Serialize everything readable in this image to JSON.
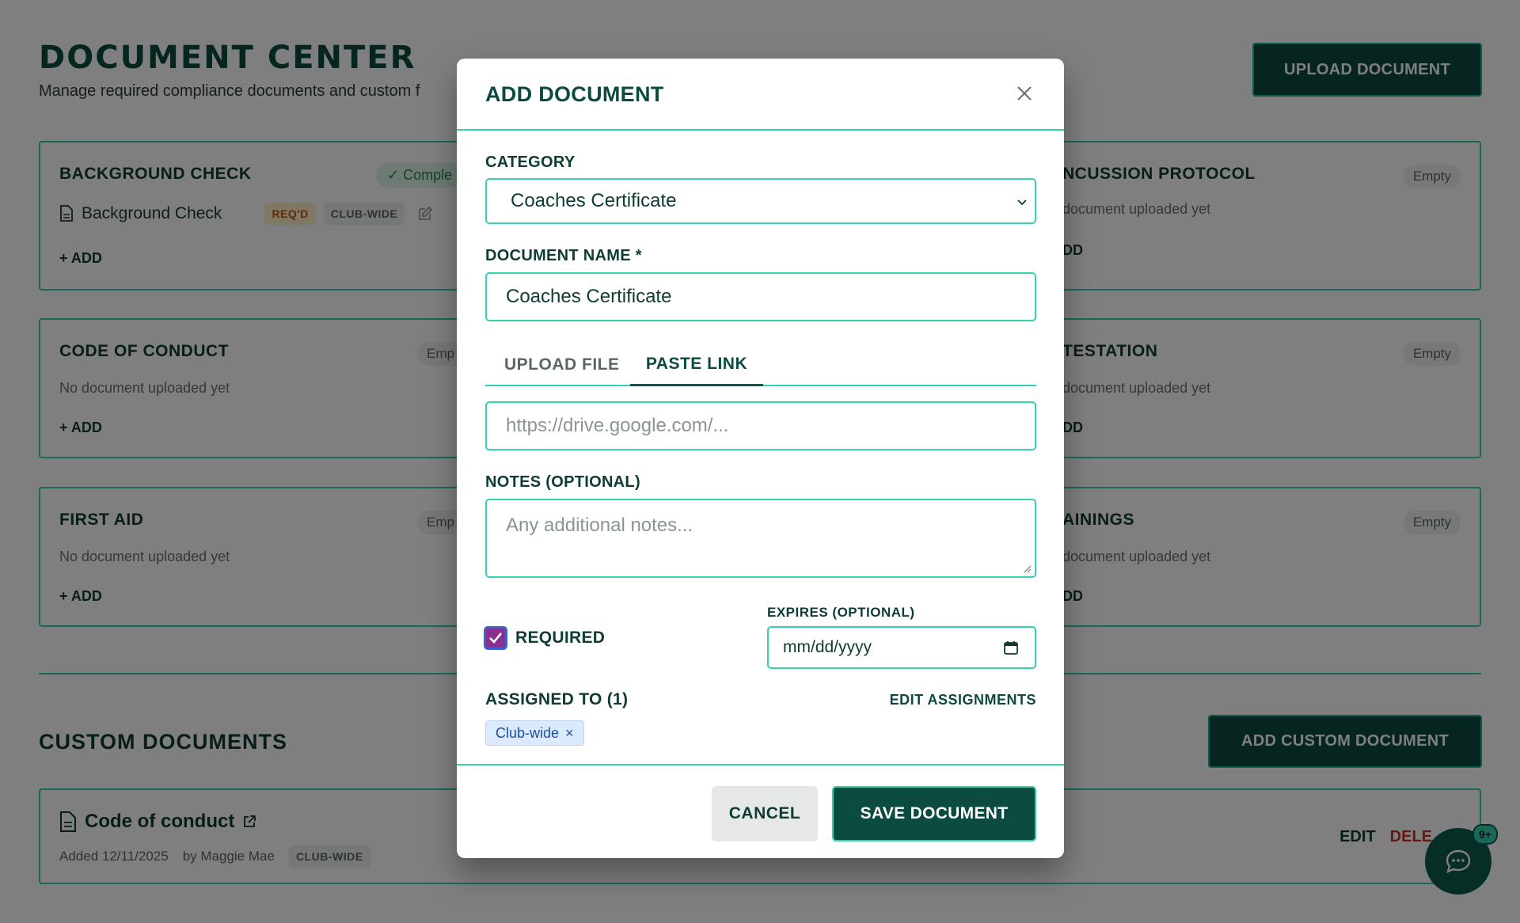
{
  "page": {
    "title": "DOCUMENT CENTER",
    "subtitle": "Manage required compliance documents and custom f",
    "upload_button": "UPLOAD DOCUMENT",
    "cards": [
      {
        "title": "BACKGROUND CHECK",
        "status": "Comple",
        "doc_name": "Background Check",
        "req_pill": "REQ'D",
        "club_pill": "CLUB-WIDE",
        "add": "+ ADD"
      },
      {
        "title": "NCUSSION PROTOCOL",
        "status": "Empty",
        "empty_text": "document uploaded yet",
        "add": "DD"
      },
      {
        "title": "CODE OF CONDUCT",
        "status": "Emp",
        "empty_text": "No document uploaded yet",
        "add": "+ ADD"
      },
      {
        "title": "TESTATION",
        "status": "Empty",
        "empty_text": "document uploaded yet",
        "add": "DD"
      },
      {
        "title": "FIRST AID",
        "status": "Emp",
        "empty_text": "No document uploaded yet",
        "add": "+ ADD"
      },
      {
        "title": "AININGS",
        "status": "Empty",
        "empty_text": "document uploaded yet",
        "add": "DD"
      }
    ],
    "custom_section_title": "CUSTOM DOCUMENTS",
    "add_custom_button": "ADD CUSTOM DOCUMENT",
    "custom_doc": {
      "name": "Code of conduct",
      "added": "Added 12/11/2025",
      "by": "by Maggie Mae",
      "scope": "CLUB-WIDE",
      "edit": "EDIT",
      "delete": "DELE"
    },
    "chat_badge": "9+"
  },
  "modal": {
    "title": "ADD DOCUMENT",
    "category_label": "CATEGORY",
    "category_value": "Coaches Certificate",
    "name_label": "DOCUMENT NAME *",
    "name_value": "Coaches Certificate",
    "tabs": {
      "upload": "UPLOAD FILE",
      "link": "PASTE LINK"
    },
    "link_placeholder": "https://drive.google.com/...",
    "notes_label": "NOTES (OPTIONAL)",
    "notes_placeholder": "Any additional notes...",
    "required_label": "REQUIRED",
    "expires_label": "EXPIRES (OPTIONAL)",
    "date_placeholder": "mm/dd/yyyy",
    "assigned_label": "ASSIGNED TO (1)",
    "edit_assignments": "EDIT ASSIGNMENTS",
    "chip": "Club-wide",
    "cancel": "CANCEL",
    "save": "SAVE DOCUMENT"
  },
  "colors": {
    "accent": "#35d1b2",
    "brand": "#0c4b40",
    "danger": "#c9302c"
  }
}
